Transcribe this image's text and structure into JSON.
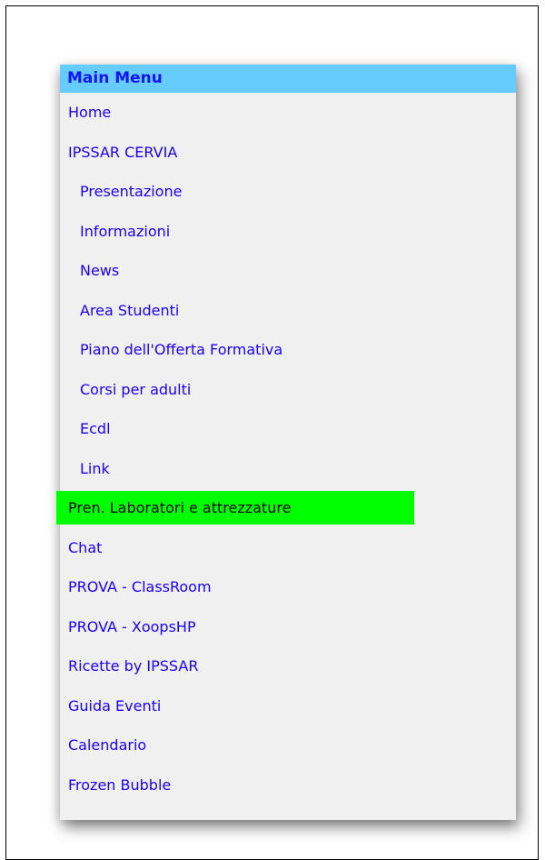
{
  "menu": {
    "title": "Main Menu",
    "items": [
      {
        "label": "Home",
        "level": 0,
        "active": false
      },
      {
        "label": "IPSSAR CERVIA",
        "level": 0,
        "active": false
      },
      {
        "label": "Presentazione",
        "level": 1,
        "active": false
      },
      {
        "label": "Informazioni",
        "level": 1,
        "active": false
      },
      {
        "label": "News",
        "level": 1,
        "active": false
      },
      {
        "label": "Area Studenti",
        "level": 1,
        "active": false
      },
      {
        "label": "Piano dell'Offerta Formativa",
        "level": 1,
        "active": false
      },
      {
        "label": "Corsi per adulti",
        "level": 1,
        "active": false
      },
      {
        "label": "Ecdl",
        "level": 1,
        "active": false
      },
      {
        "label": "Link",
        "level": 1,
        "active": false
      },
      {
        "label": "Pren. Laboratori e attrezzature",
        "level": 0,
        "active": true
      },
      {
        "label": "Chat",
        "level": 0,
        "active": false
      },
      {
        "label": "PROVA - ClassRoom",
        "level": 0,
        "active": false
      },
      {
        "label": "PROVA - XoopsHP",
        "level": 0,
        "active": false
      },
      {
        "label": "Ricette by IPSSAR",
        "level": 0,
        "active": false
      },
      {
        "label": "Guida Eventi",
        "level": 0,
        "active": false
      },
      {
        "label": "Calendario",
        "level": 0,
        "active": false
      },
      {
        "label": "Frozen Bubble",
        "level": 0,
        "active": false
      }
    ]
  },
  "colors": {
    "title_bg": "#66ccff",
    "title_text": "#1414ff",
    "link": "#1a00ff",
    "active_bg": "#00ff00",
    "menu_bg": "#f0f0f0"
  }
}
